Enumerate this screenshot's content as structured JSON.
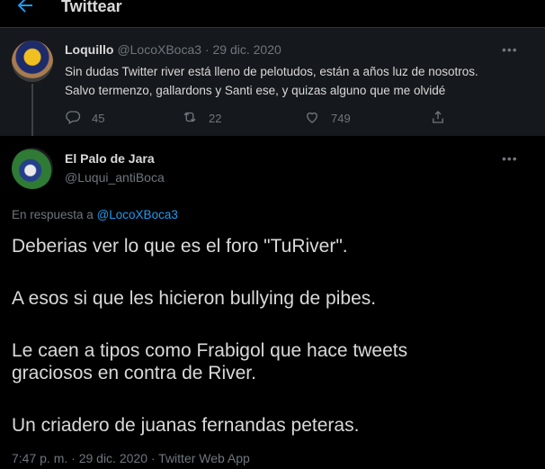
{
  "header": {
    "title": "Twittear"
  },
  "parent_tweet": {
    "name": "Loquillo",
    "handle": "@LocoXBoca3",
    "date": "· 29 dic. 2020",
    "text_line1": "Sin dudas Twitter river está lleno de pelotudos, están a años luz de nosotros.",
    "text_line2": "Salvo termenzo, gallardons y Santi ese, y quizas alguno que me olvidé",
    "replies": "45",
    "retweets": "22",
    "likes": "749"
  },
  "main_tweet": {
    "name": "El Palo de Jara",
    "handle": "@Luqui_antiBoca",
    "reply_prefix": "En respuesta a",
    "reply_to": "@LocoXBoca3",
    "paragraphs": [
      "Deberias ver lo que es el foro \"TuRiver\".",
      "A esos si que les hicieron bullying de pibes.",
      "Le caen a tipos como Frabigol que hace tweets graciosos en contra de River.",
      "Un criadero de juanas fernandas peteras."
    ],
    "meta": "7:47 p. m. · 29 dic. 2020 · Twitter Web App"
  },
  "icons": [
    "back-arrow-icon",
    "more-icon",
    "reply-icon",
    "retweet-icon",
    "like-icon",
    "share-icon"
  ],
  "colors": {
    "background": "#000000",
    "parent_bg": "#15181c",
    "accent": "#1d9bf0",
    "muted": "#6e767d"
  }
}
